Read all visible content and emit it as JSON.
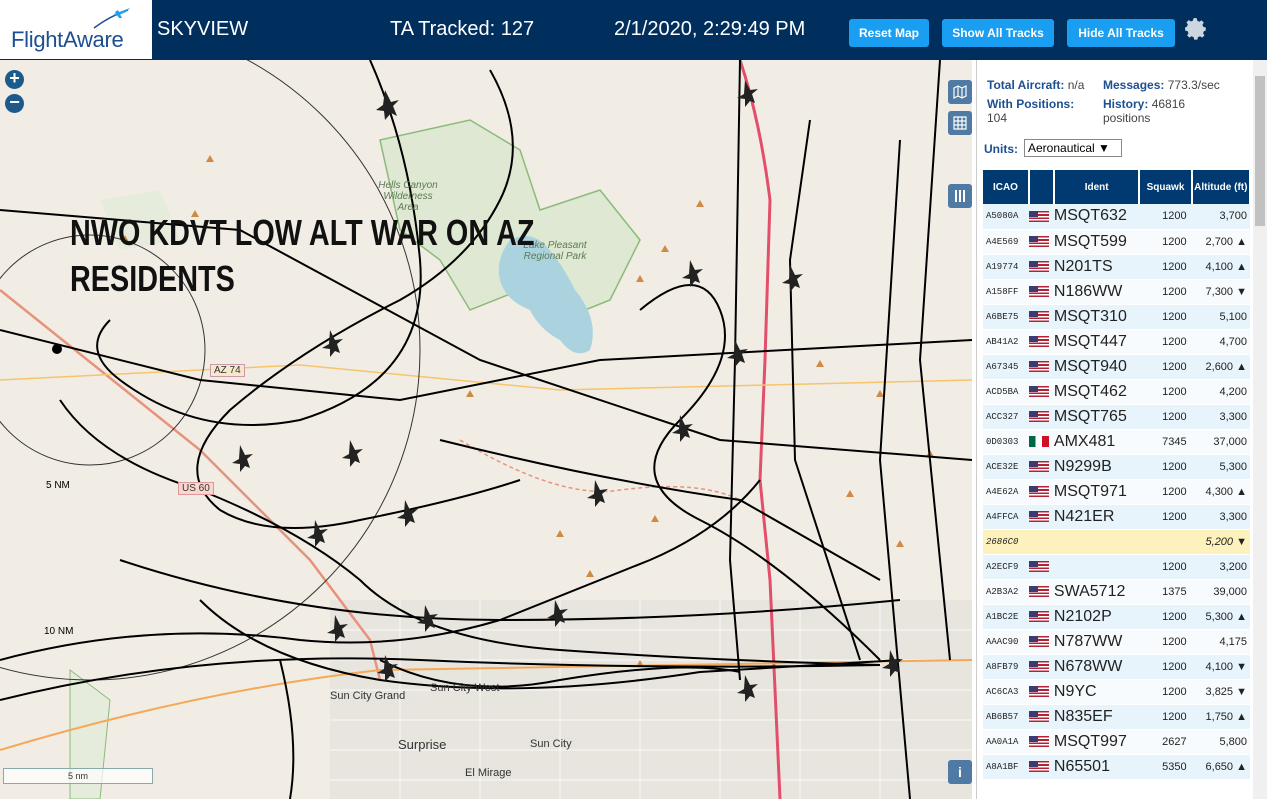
{
  "header": {
    "logo": "FlightAware",
    "app_title": "SKYVIEW",
    "tracked": "TA Tracked: 127",
    "datetime": "2/1/2020, 2:29:49 PM",
    "buttons": {
      "reset": "Reset Map",
      "show_all": "Show All Tracks",
      "hide_all": "Hide All Tracks"
    },
    "settings_icon": "gear-icon"
  },
  "map": {
    "overlay_text": "NWO KDVT LOW ALT WAR ON AZ RESIDENTS",
    "labels": {
      "hells_canyon": "Hells Canyon Wilderness Area",
      "lake_pleasant": "Lake Pleasant Regional Park",
      "sun_city_grand": "Sun City Grand",
      "sun_city_west": "Sun City West",
      "surprise": "Surprise",
      "sun_city": "Sun City",
      "el_mirage": "El Mirage",
      "az74": "AZ 74",
      "us60": "US 60",
      "ring_5nm": "5 NM",
      "ring_10nm": "10 NM"
    },
    "scale": "5 nm",
    "zoom_in": "+",
    "zoom_out": "−",
    "info": "i"
  },
  "sidebar": {
    "total_aircraft_label": "Total Aircraft:",
    "total_aircraft": "n/a",
    "messages_label": "Messages:",
    "messages": "773.3/sec",
    "with_positions_label": "With Positions:",
    "with_positions": "104",
    "history_label": "History:",
    "history": "46816 positions",
    "units_label": "Units:",
    "units_value": "Aeronautical ▼",
    "columns": [
      "ICAO",
      "Ident",
      "Squawk",
      "Altitude (ft)"
    ],
    "rows": [
      {
        "icao": "A5080A",
        "flag": "us",
        "ident": "MSQT632",
        "squawk": "1200",
        "alt": "3,700"
      },
      {
        "icao": "A4E569",
        "flag": "us",
        "ident": "MSQT599",
        "squawk": "1200",
        "alt": "2,700 ▲"
      },
      {
        "icao": "A19774",
        "flag": "us",
        "ident": "N201TS",
        "squawk": "1200",
        "alt": "4,100 ▲"
      },
      {
        "icao": "A158FF",
        "flag": "us",
        "ident": "N186WW",
        "squawk": "1200",
        "alt": "7,300 ▼"
      },
      {
        "icao": "A6BE75",
        "flag": "us",
        "ident": "MSQT310",
        "squawk": "1200",
        "alt": "5,100"
      },
      {
        "icao": "AB41A2",
        "flag": "us",
        "ident": "MSQT447",
        "squawk": "1200",
        "alt": "4,700"
      },
      {
        "icao": "A67345",
        "flag": "us",
        "ident": "MSQT940",
        "squawk": "1200",
        "alt": "2,600 ▲"
      },
      {
        "icao": "ACD5BA",
        "flag": "us",
        "ident": "MSQT462",
        "squawk": "1200",
        "alt": "4,200"
      },
      {
        "icao": "ACC327",
        "flag": "us",
        "ident": "MSQT765",
        "squawk": "1200",
        "alt": "3,300"
      },
      {
        "icao": "0D0303",
        "flag": "mx",
        "ident": "AMX481",
        "squawk": "7345",
        "alt": "37,000"
      },
      {
        "icao": "ACE32E",
        "flag": "us",
        "ident": "N9299B",
        "squawk": "1200",
        "alt": "5,300"
      },
      {
        "icao": "A4E62A",
        "flag": "us",
        "ident": "MSQT971",
        "squawk": "1200",
        "alt": "4,300 ▲"
      },
      {
        "icao": "A4FFCA",
        "flag": "us",
        "ident": "N421ER",
        "squawk": "1200",
        "alt": "3,300"
      },
      {
        "icao": "2686C0",
        "flag": "",
        "ident": "",
        "squawk": "",
        "alt": "5,200 ▼",
        "highlight": true
      },
      {
        "icao": "A2ECF9",
        "flag": "us",
        "ident": "",
        "squawk": "1200",
        "alt": "3,200"
      },
      {
        "icao": "A2B3A2",
        "flag": "us",
        "ident": "SWA5712",
        "squawk": "1375",
        "alt": "39,000"
      },
      {
        "icao": "A1BC2E",
        "flag": "us",
        "ident": "N2102P",
        "squawk": "1200",
        "alt": "5,300 ▲"
      },
      {
        "icao": "AAAC90",
        "flag": "us",
        "ident": "N787WW",
        "squawk": "1200",
        "alt": "4,175"
      },
      {
        "icao": "A8FB79",
        "flag": "us",
        "ident": "N678WW",
        "squawk": "1200",
        "alt": "4,100 ▼"
      },
      {
        "icao": "AC6CA3",
        "flag": "us",
        "ident": "N9YC",
        "squawk": "1200",
        "alt": "3,825 ▼"
      },
      {
        "icao": "AB6B57",
        "flag": "us",
        "ident": "N835EF",
        "squawk": "1200",
        "alt": "1,750 ▲"
      },
      {
        "icao": "AA0A1A",
        "flag": "us",
        "ident": "MSQT997",
        "squawk": "2627",
        "alt": "5,800"
      },
      {
        "icao": "A8A1BF",
        "flag": "us",
        "ident": "N65501",
        "squawk": "5350",
        "alt": "6,650 ▲"
      }
    ]
  }
}
